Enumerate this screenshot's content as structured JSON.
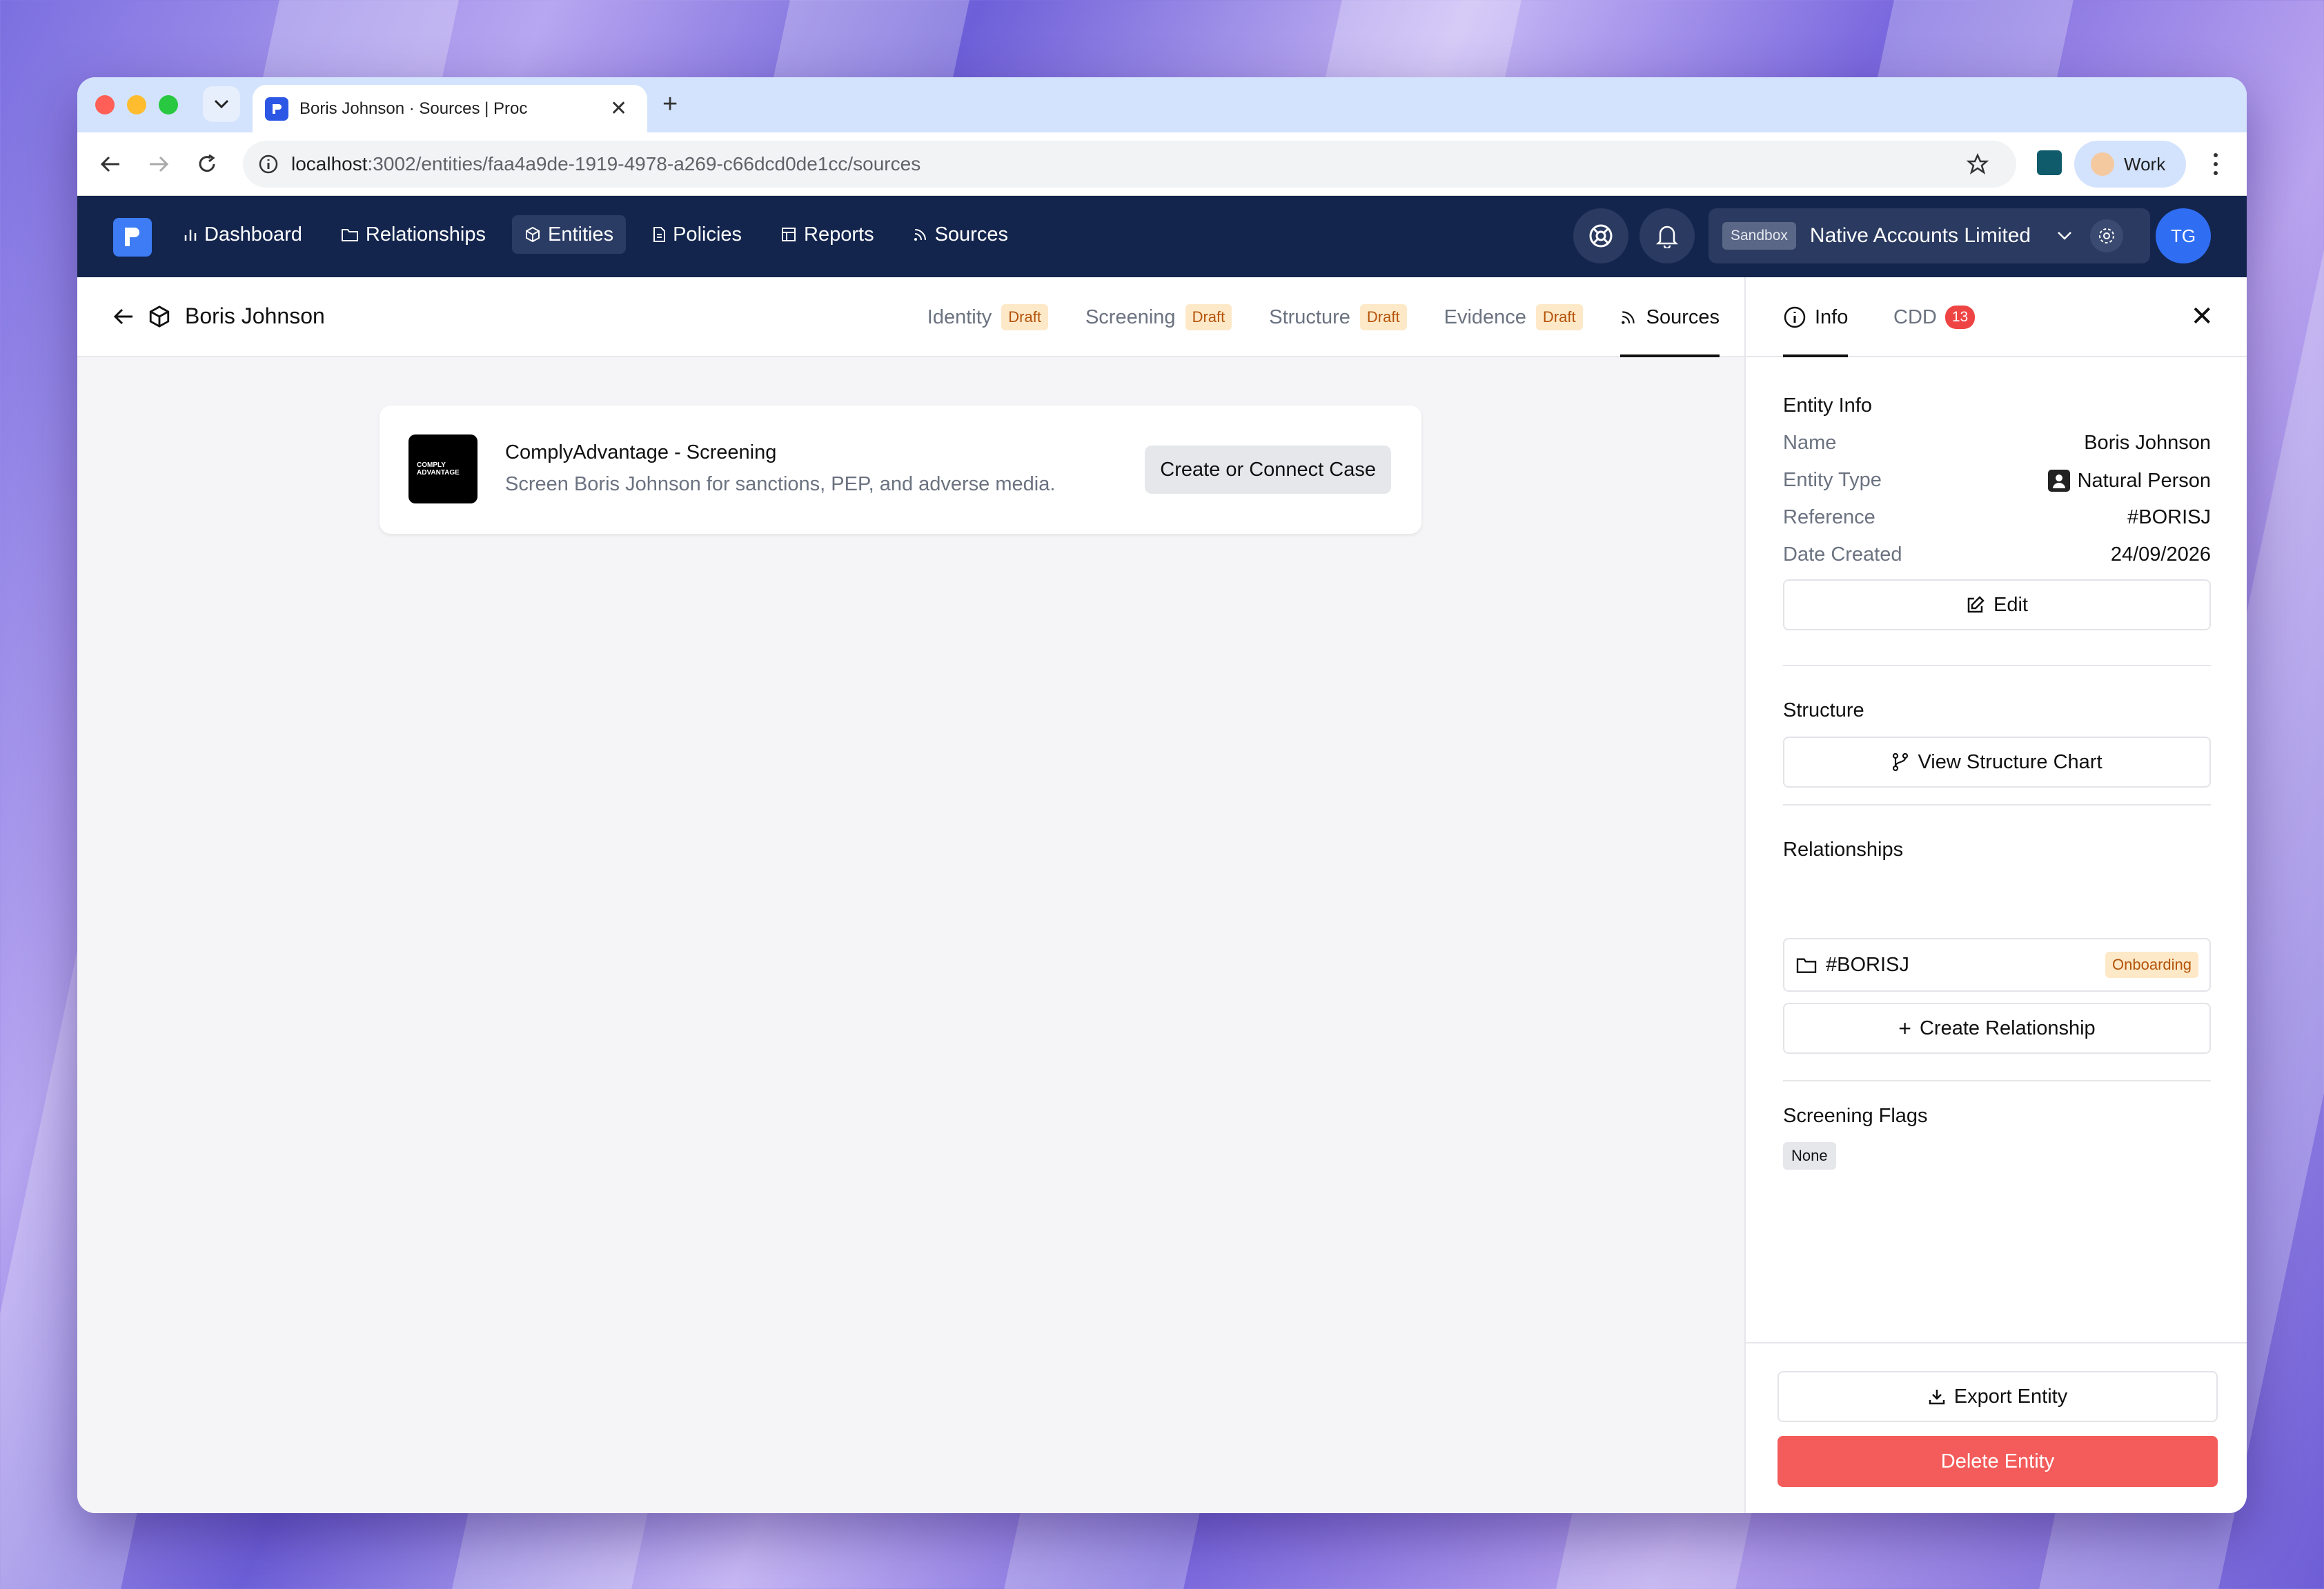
{
  "browser": {
    "tab_title": "Boris Johnson · Sources | Proc",
    "url_host": "localhost",
    "url_rest": ":3002/entities/faa4a9de-1919-4978-a269-c66dcd0de1cc/sources",
    "profile_label": "Work"
  },
  "nav": {
    "items": [
      {
        "label": "Dashboard",
        "icon": "bar-chart-icon"
      },
      {
        "label": "Relationships",
        "icon": "folder-icon"
      },
      {
        "label": "Entities",
        "icon": "cube-icon"
      },
      {
        "label": "Policies",
        "icon": "document-icon"
      },
      {
        "label": "Reports",
        "icon": "table-icon"
      },
      {
        "label": "Sources",
        "icon": "rss-icon"
      }
    ],
    "active": "Entities",
    "sandbox_label": "Sandbox",
    "org_name": "Native Accounts Limited",
    "user_initials": "TG"
  },
  "entity": {
    "name": "Boris Johnson",
    "subtabs": [
      {
        "label": "Identity",
        "badge": "Draft"
      },
      {
        "label": "Screening",
        "badge": "Draft"
      },
      {
        "label": "Structure",
        "badge": "Draft"
      },
      {
        "label": "Evidence",
        "badge": "Draft"
      },
      {
        "label": "Sources",
        "badge": ""
      }
    ]
  },
  "source_card": {
    "logo_text_1": "COMPLY",
    "logo_text_2": "ADVANTAGE",
    "title": "ComplyAdvantage - Screening",
    "description": "Screen Boris Johnson for sanctions, PEP, and adverse media.",
    "button": "Create or Connect Case"
  },
  "side_panel": {
    "tab_info": "Info",
    "tab_cdd": "CDD",
    "cdd_count": "13",
    "entity_info_title": "Entity Info",
    "fields": [
      {
        "key": "Name",
        "value": "Boris Johnson"
      },
      {
        "key": "Entity Type",
        "value": "Natural Person"
      },
      {
        "key": "Reference",
        "value": "#BORISJ"
      },
      {
        "key": "Date Created",
        "value": "24/09/2026"
      }
    ],
    "edit_button": "Edit",
    "structure_title": "Structure",
    "structure_button": "View Structure Chart",
    "relationships_title": "Relationships",
    "relationship_ref": "#BORISJ",
    "relationship_status": "Onboarding",
    "create_relationship_button": "Create Relationship",
    "screening_flags_title": "Screening Flags",
    "screening_flags_value": "None",
    "export_button": "Export Entity",
    "delete_button": "Delete Entity"
  },
  "colors": {
    "nav_bg": "#13254d",
    "accent_blue": "#2f6ef3",
    "delete_red": "#f45b5b",
    "draft_bg": "#fde9c8",
    "draft_text": "#b45309"
  }
}
